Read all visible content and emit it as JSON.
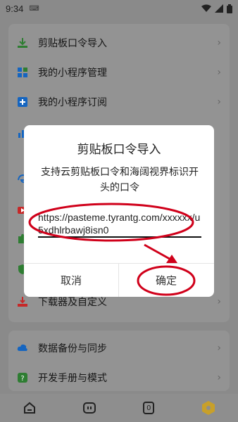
{
  "status_bar": {
    "time": "9:34",
    "keyboard_icon": "keyboard-icon",
    "wifi_icon": "wifi-icon",
    "signal_icon": "signal-icon",
    "battery_icon": "battery-icon"
  },
  "menu": {
    "items": [
      {
        "label": "剪贴板口令导入",
        "icon": "download-icon",
        "color": "#2e7d32"
      },
      {
        "label": "我的小程序管理",
        "icon": "grid-icon",
        "color": "#1565c0"
      },
      {
        "label": "我的小程序订阅",
        "icon": "subscribe-icon",
        "color": "#1565c0"
      },
      {
        "label": "",
        "icon": "chart-icon",
        "color": "#1565c0"
      },
      {
        "label": "",
        "icon": "edge-icon",
        "color": "#1565c0"
      },
      {
        "label": "",
        "icon": "video-icon",
        "color": "#c62828"
      },
      {
        "label": "",
        "icon": "puzzle-icon",
        "color": "#2e7d32"
      },
      {
        "label": "",
        "icon": "shield-icon",
        "color": "#2e7d32"
      },
      {
        "label": "下载器及自定义",
        "icon": "downloader-icon",
        "color": "#c62828"
      }
    ],
    "bottom_items": [
      {
        "label": "数据备份与同步",
        "icon": "cloud-sync-icon",
        "color": "#1565c0"
      },
      {
        "label": "开发手册与模式",
        "icon": "help-icon",
        "color": "#2e7d32"
      }
    ]
  },
  "bottom_nav": {
    "items": [
      {
        "icon": "home-icon"
      },
      {
        "icon": "bot-icon"
      },
      {
        "icon": "tabs-count-icon",
        "count": "0"
      },
      {
        "icon": "hexagon-icon"
      }
    ]
  },
  "dialog": {
    "title": "剪贴板口令导入",
    "message": "支持云剪贴板口令和海阔视界标识开头的口令",
    "input_value": "https://pasteme.tyrantg.com/xxxxxx/u5xdhlrbawj8isn0",
    "cancel_label": "取消",
    "ok_label": "确定"
  },
  "colors": {
    "annotation_red": "#d0001a",
    "accent_green": "#2e7d32",
    "accent_blue": "#1565c0"
  }
}
